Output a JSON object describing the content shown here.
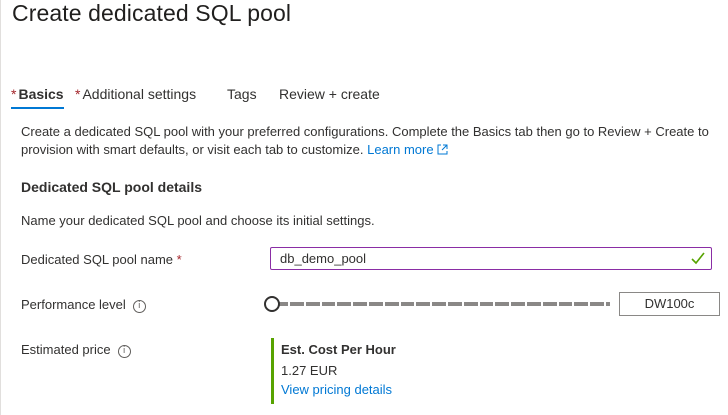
{
  "page": {
    "title": "Create dedicated SQL pool"
  },
  "tabs": [
    {
      "label": "Basics",
      "required": "*",
      "active": true
    },
    {
      "label": "Additional settings",
      "required": "*"
    },
    {
      "label": "Tags"
    },
    {
      "label": "Review + create"
    }
  ],
  "intro": {
    "text": "Create a dedicated SQL pool with your preferred configurations. Complete the Basics tab then go to Review + Create to provision with smart defaults, or visit each tab to customize.",
    "learn_more": "Learn more"
  },
  "section": {
    "heading": "Dedicated SQL pool details",
    "subtext": "Name your dedicated SQL pool and choose its initial settings."
  },
  "form": {
    "pool_name": {
      "label": "Dedicated SQL pool name",
      "required": "*",
      "value": "db_demo_pool"
    },
    "performance": {
      "label": "Performance level",
      "info": "i",
      "value": "DW100c",
      "slider_fraction": 0
    },
    "estimated_price": {
      "label": "Estimated price",
      "info": "i",
      "heading": "Est. Cost Per Hour",
      "amount": "1.27 EUR",
      "link": "View pricing details"
    }
  },
  "colors": {
    "accent": "#0078d4",
    "required": "#a4262c",
    "valid": "#57a300",
    "focus_border": "#8a2da5"
  },
  "icons": {
    "external_link": "external-link-icon",
    "valid": "checkmark-icon",
    "info": "info-icon"
  }
}
